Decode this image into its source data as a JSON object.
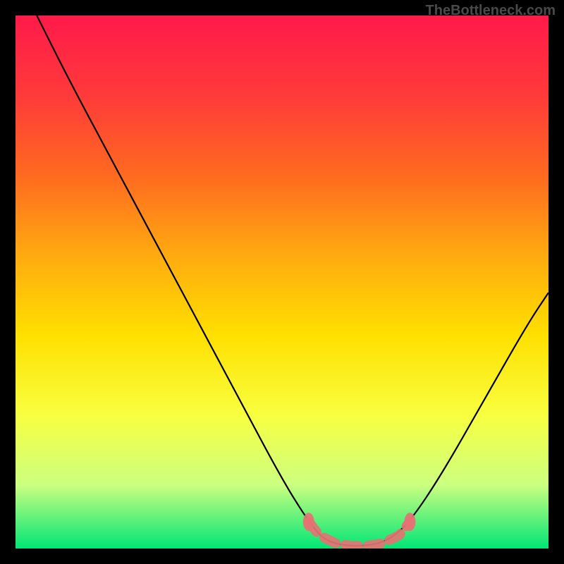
{
  "watermark": "TheBottleneck.com",
  "chart_data": {
    "type": "line",
    "title": "",
    "xlabel": "",
    "ylabel": "",
    "xlim": [
      0,
      100
    ],
    "ylim": [
      0,
      100
    ],
    "gradient_stops": [
      {
        "offset": 0,
        "color": "#ff1a4a"
      },
      {
        "offset": 15,
        "color": "#ff3a3a"
      },
      {
        "offset": 30,
        "color": "#ff6a20"
      },
      {
        "offset": 45,
        "color": "#ffaa10"
      },
      {
        "offset": 60,
        "color": "#ffe000"
      },
      {
        "offset": 75,
        "color": "#f8ff40"
      },
      {
        "offset": 88,
        "color": "#ccff80"
      },
      {
        "offset": 100,
        "color": "#00e676"
      }
    ],
    "series": [
      {
        "name": "bottleneck-curve",
        "color": "#000000",
        "points": [
          {
            "x": 4,
            "y": 100
          },
          {
            "x": 10,
            "y": 88
          },
          {
            "x": 18,
            "y": 73
          },
          {
            "x": 26,
            "y": 58
          },
          {
            "x": 34,
            "y": 43
          },
          {
            "x": 42,
            "y": 28
          },
          {
            "x": 50,
            "y": 13
          },
          {
            "x": 55,
            "y": 5
          },
          {
            "x": 58,
            "y": 1.5
          },
          {
            "x": 62,
            "y": 0.5
          },
          {
            "x": 66,
            "y": 0.5
          },
          {
            "x": 70,
            "y": 1.5
          },
          {
            "x": 74,
            "y": 5
          },
          {
            "x": 80,
            "y": 14
          },
          {
            "x": 88,
            "y": 28
          },
          {
            "x": 96,
            "y": 42
          },
          {
            "x": 100,
            "y": 48
          }
        ]
      }
    ],
    "markers": {
      "name": "highlight-region",
      "color": "#e57373",
      "points": [
        {
          "x": 55,
          "y": 5
        },
        {
          "x": 57,
          "y": 2.5
        },
        {
          "x": 60,
          "y": 1
        },
        {
          "x": 63,
          "y": 0.5
        },
        {
          "x": 66,
          "y": 0.5
        },
        {
          "x": 69,
          "y": 1
        },
        {
          "x": 72,
          "y": 2.5
        },
        {
          "x": 74,
          "y": 5
        }
      ]
    }
  }
}
